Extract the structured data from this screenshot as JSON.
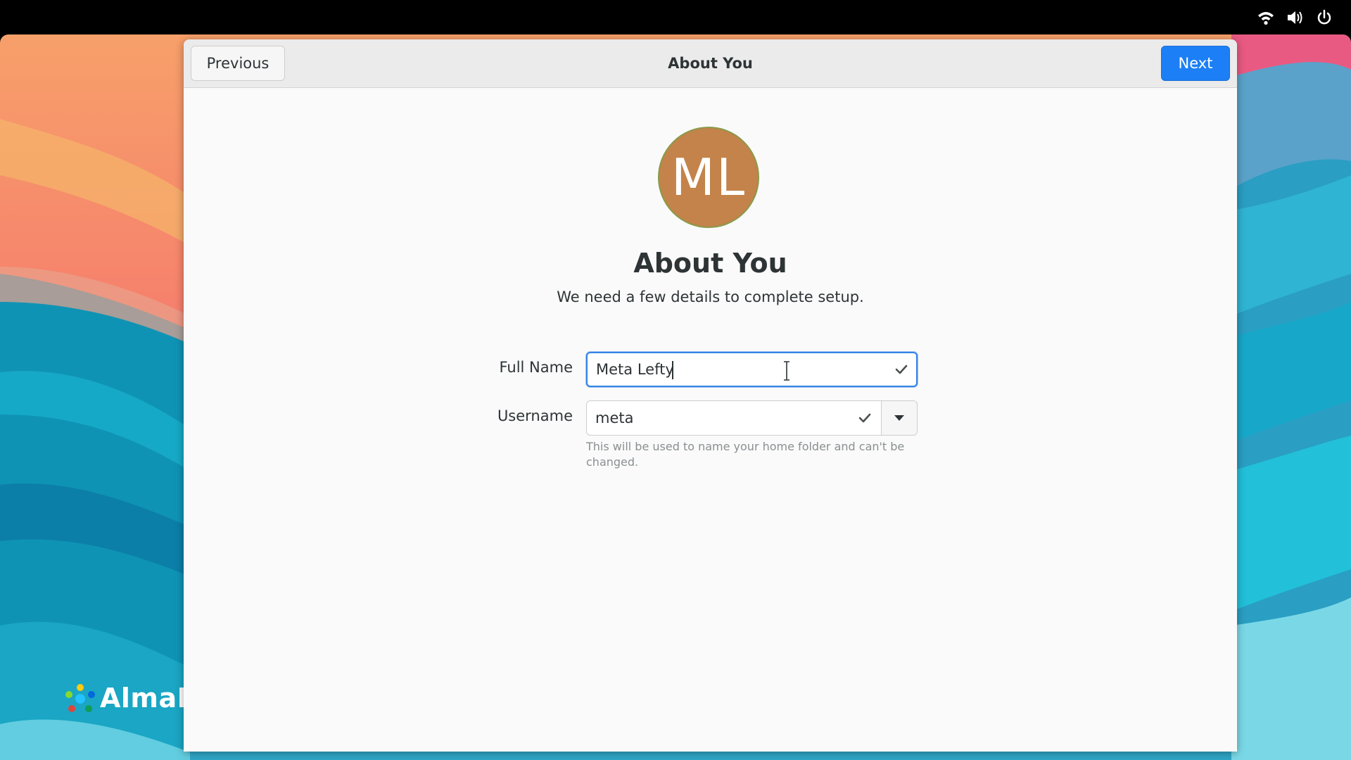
{
  "tray": {
    "wifi_icon": "wifi-icon",
    "volume_icon": "volume-icon",
    "power_icon": "power-icon"
  },
  "desktop": {
    "logo_text": "AlmaLi"
  },
  "window": {
    "title": "About You",
    "previous_label": "Previous",
    "next_label": "Next",
    "accent_color": "#1c7ff5"
  },
  "avatar": {
    "initials": "ML",
    "color": "#c3834a"
  },
  "page": {
    "heading": "About You",
    "subtitle": "We need a few details to complete setup."
  },
  "form": {
    "full_name": {
      "label": "Full Name",
      "value": "Meta Lefty"
    },
    "username": {
      "label": "Username",
      "value": "meta",
      "hint": "This will be used to name your home folder and can't be changed."
    }
  }
}
